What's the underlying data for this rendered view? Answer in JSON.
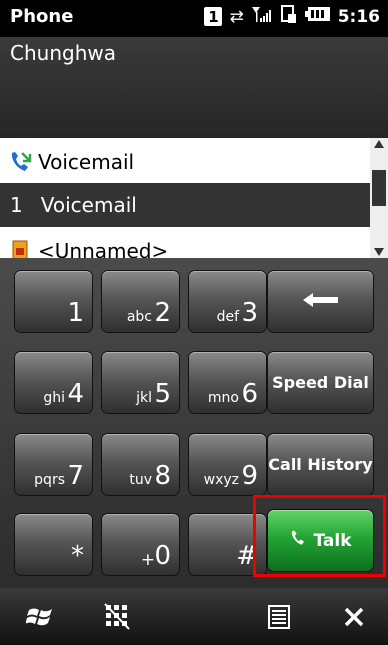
{
  "status_bar": {
    "app_name": "Phone",
    "sim_indicator": "1",
    "time": "5:16",
    "icons": [
      "sim-icon",
      "data-transfer-icon",
      "signal-icon",
      "sync-icon",
      "battery-icon"
    ]
  },
  "carrier": "Chunghwa",
  "contact_list": {
    "rows": [
      {
        "icon": "voicemail-phone-icon",
        "label": "Voicemail"
      },
      {
        "speed_dial": "1",
        "label": "Voicemail"
      },
      {
        "icon": "sim-contact-icon",
        "label": "<Unnamed>"
      }
    ],
    "selected_index": 1
  },
  "keypad": {
    "keys": [
      {
        "main": "1",
        "sub": ""
      },
      {
        "main": "2",
        "sub": "abc"
      },
      {
        "main": "3",
        "sub": "def"
      },
      {
        "main": "4",
        "sub": "ghi"
      },
      {
        "main": "5",
        "sub": "jkl"
      },
      {
        "main": "6",
        "sub": "mno"
      },
      {
        "main": "7",
        "sub": "pqrs"
      },
      {
        "main": "8",
        "sub": "tuv"
      },
      {
        "main": "9",
        "sub": "wxyz"
      },
      {
        "main": "*",
        "sub": ""
      },
      {
        "main": "0",
        "sub": "+"
      },
      {
        "main": "#",
        "sub": ""
      }
    ],
    "backspace_icon": "backspace-arrow-icon",
    "speed_dial_label": "Speed Dial",
    "call_history_label": "Call History",
    "talk_label": "Talk",
    "talk_color": "#22a534"
  },
  "bottom_bar": {
    "icons": [
      "windows-start-icon",
      "keypad-toggle-icon",
      "menu-icon",
      "close-icon"
    ]
  },
  "highlight_color": "#e00000"
}
